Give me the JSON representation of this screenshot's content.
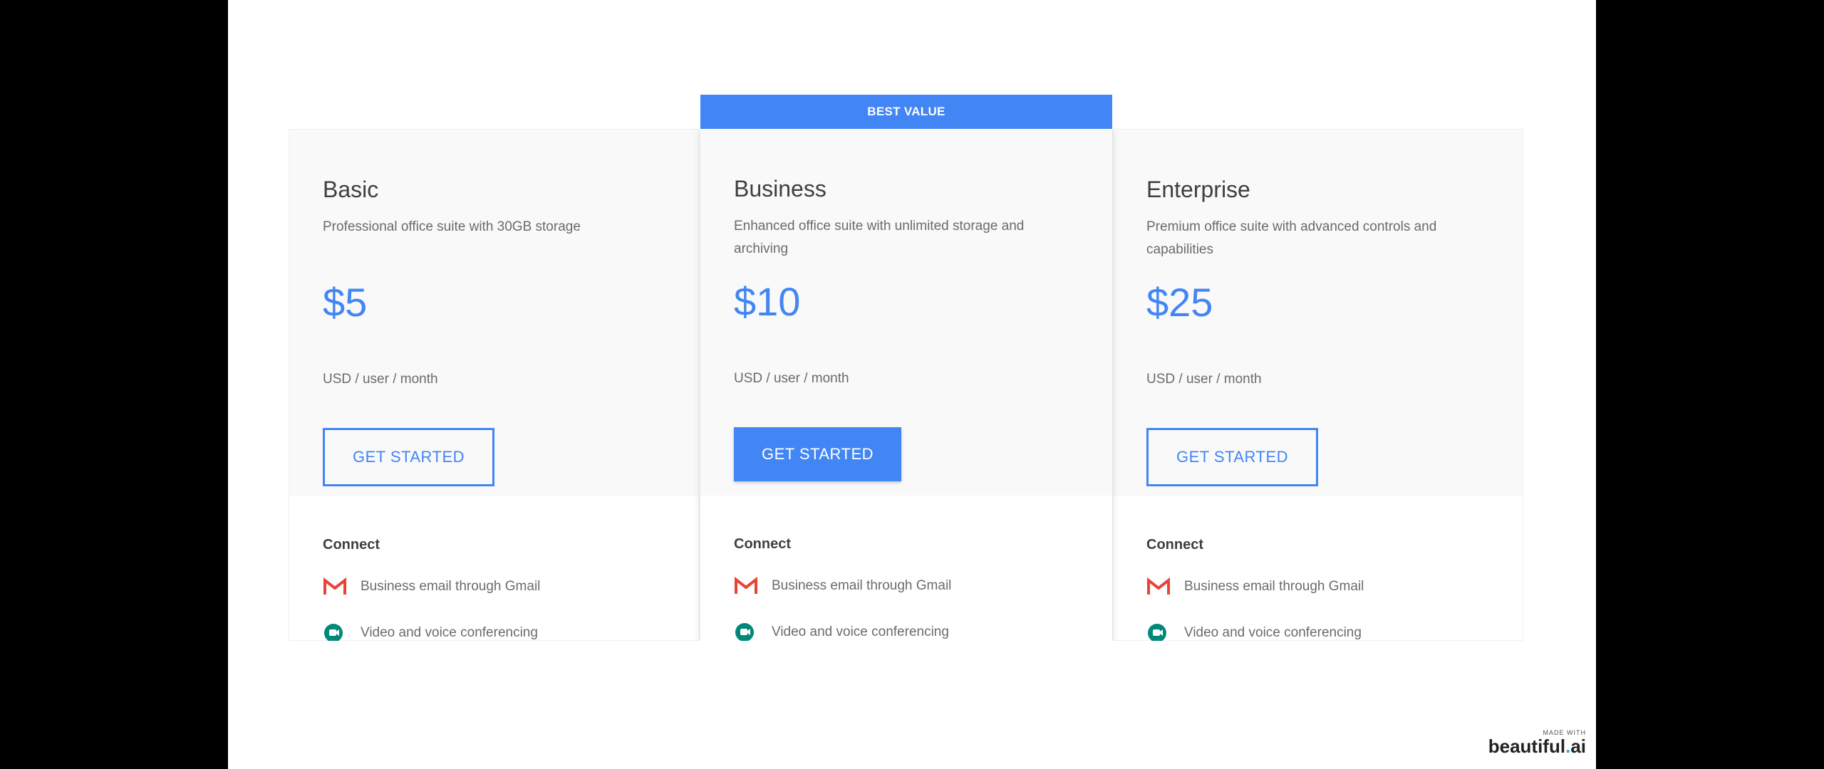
{
  "ribbon": "BEST VALUE",
  "plans": [
    {
      "name": "Basic",
      "description": "Professional office suite with 30GB storage",
      "price": "$5",
      "unit": "USD / user / month",
      "cta": "GET STARTED",
      "section": "Connect",
      "features": [
        "Business email through Gmail",
        "Video and voice conferencing"
      ]
    },
    {
      "name": "Business",
      "description": "Enhanced office suite with unlimited storage and archiving",
      "price": "$10",
      "unit": "USD / user / month",
      "cta": "GET STARTED",
      "section": "Connect",
      "features": [
        "Business email through Gmail",
        "Video and voice conferencing"
      ]
    },
    {
      "name": "Enterprise",
      "description": "Premium office suite with advanced controls and capabilities",
      "price": "$25",
      "unit": "USD / user / month",
      "cta": "GET STARTED",
      "section": "Connect",
      "features": [
        "Business email through Gmail",
        "Video and voice conferencing"
      ]
    }
  ],
  "icons": {
    "feature_1": "gmail-icon",
    "feature_2": "meet-icon"
  },
  "colors": {
    "accent": "#4285f4",
    "gmail_red": "#ea4335",
    "meet_teal": "#00897b"
  },
  "watermark": {
    "made_with": "MADE WITH",
    "brand_left": "beautiful",
    "brand_dot": ".",
    "brand_right": "ai"
  }
}
